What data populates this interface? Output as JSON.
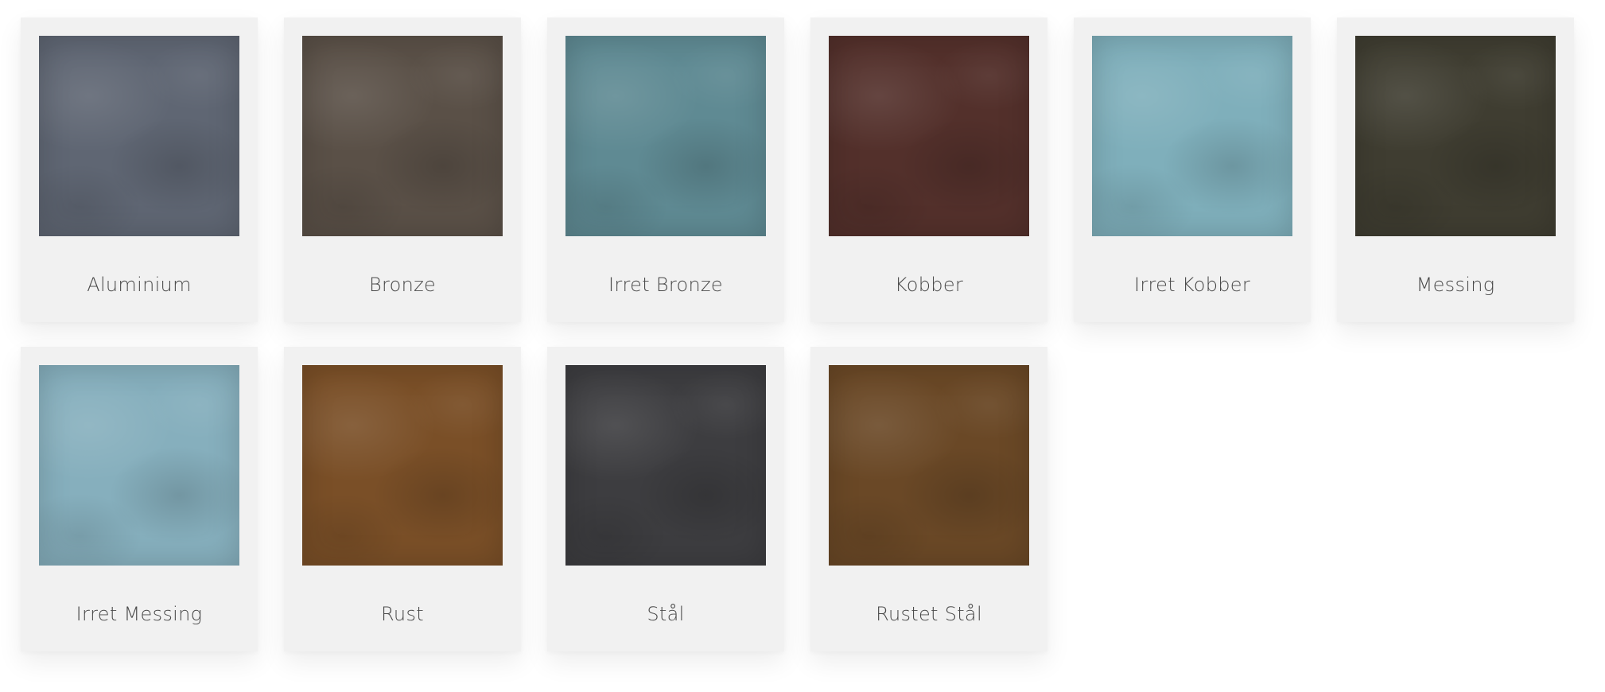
{
  "swatches": [
    {
      "label": "Aluminium",
      "color": "#5f6673"
    },
    {
      "label": "Bronze",
      "color": "#5a5047"
    },
    {
      "label": "Irret Bronze",
      "color": "#5f8a93"
    },
    {
      "label": "Kobber",
      "color": "#53302b"
    },
    {
      "label": "Irret Kobber",
      "color": "#7fafbb"
    },
    {
      "label": "Messing",
      "color": "#3f3d31"
    },
    {
      "label": "Irret Messing",
      "color": "#86afbd"
    },
    {
      "label": "Rust",
      "color": "#7a4f27"
    },
    {
      "label": "Stål",
      "color": "#3d3d40"
    },
    {
      "label": "Rustet Stål",
      "color": "#6a4826"
    }
  ]
}
